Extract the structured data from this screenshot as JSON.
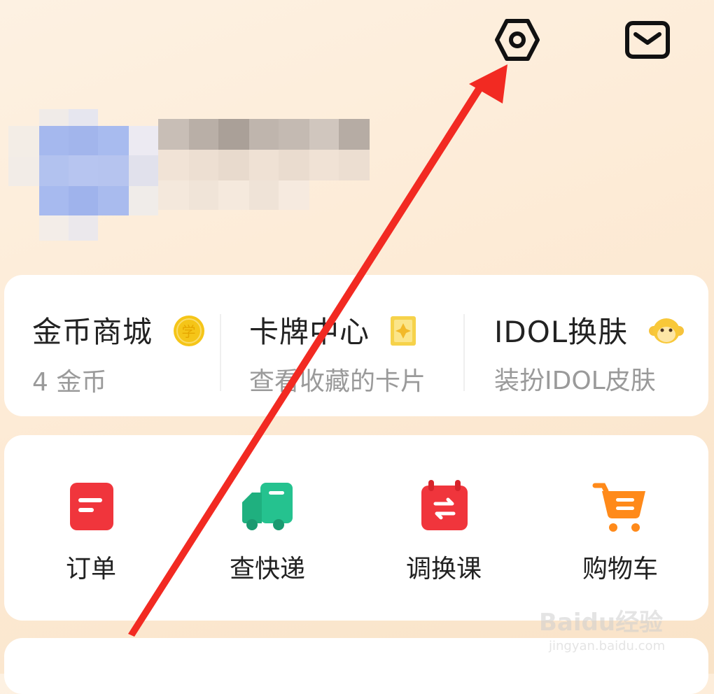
{
  "header": {
    "settings_icon": "settings-hexagon-icon",
    "mail_icon": "mail-icon"
  },
  "features": [
    {
      "title": "金币商城",
      "subtitle": "4 金币",
      "badge": "coin-icon",
      "badge_char": "学"
    },
    {
      "title": "卡牌中心",
      "subtitle": "查看收藏的卡片",
      "badge": "card-icon"
    },
    {
      "title": "IDOL换肤",
      "subtitle": "装扮IDOL皮肤",
      "badge": "monkey-icon"
    }
  ],
  "quick_actions": [
    {
      "label": "订单",
      "icon": "order-icon",
      "color": "#f0353c"
    },
    {
      "label": "查快递",
      "icon": "delivery-truck-icon",
      "color": "#25c28f"
    },
    {
      "label": "调换课",
      "icon": "swap-calendar-icon",
      "color": "#f0353c"
    },
    {
      "label": "购物车",
      "icon": "shopping-cart-icon",
      "color": "#ff8a1a"
    }
  ],
  "annotation": {
    "arrow_color": "#f22a22"
  },
  "watermark": {
    "brand": "Baidu",
    "suffix": "经验",
    "url": "jingyan.baidu.com"
  },
  "colors": {
    "background": "#fdebd6",
    "card": "#ffffff",
    "coin": "#f5c518"
  }
}
